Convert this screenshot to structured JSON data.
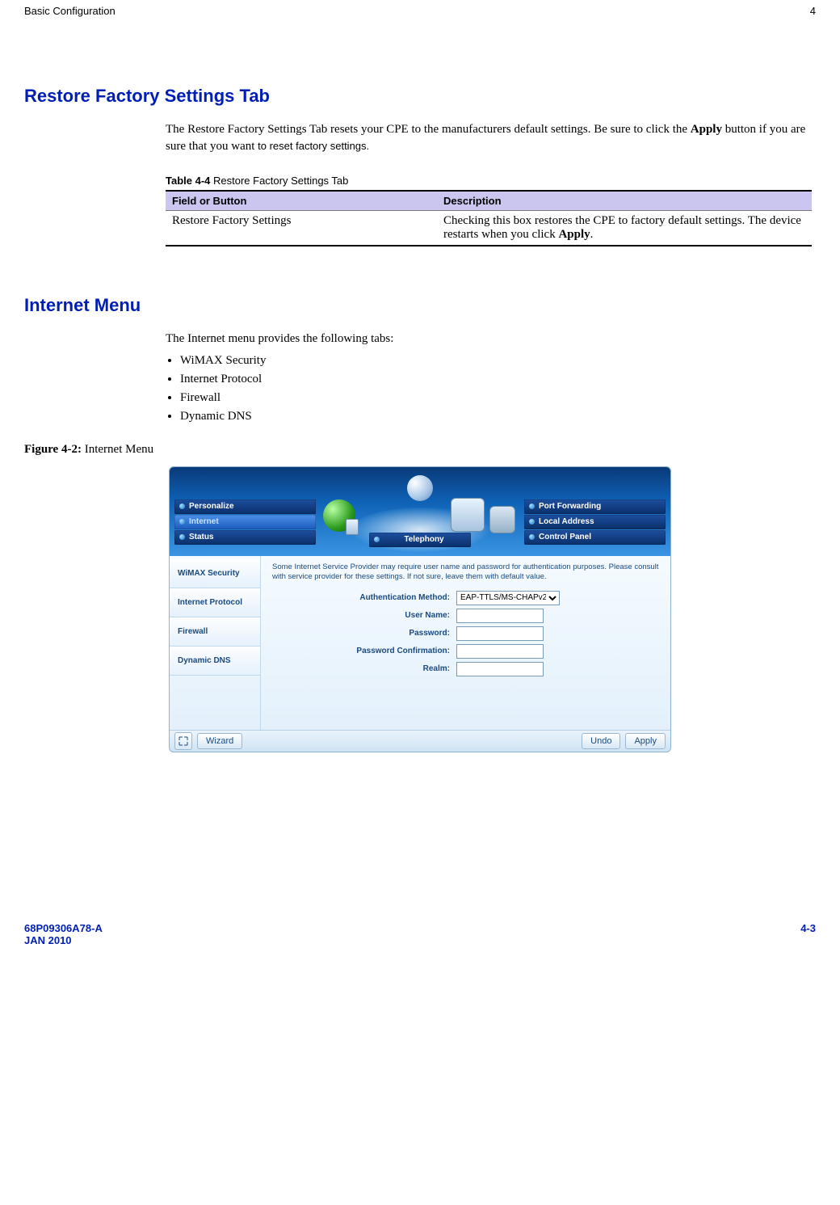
{
  "header": {
    "left": "Basic Configuration",
    "right": "4"
  },
  "section1": {
    "heading": "Restore Factory Settings Tab",
    "body_html": "The Restore Factory Settings Tab resets your CPE to the manufacturers default settings. Be sure to click the <b>Apply</b> button if you are sure that you want <span class='sans'>to reset factory settings.</span>",
    "table_caption_html": "<b>Table 4-4</b> Restore Factory Settings Tab",
    "table": {
      "headers": [
        "Field or Button",
        "Description"
      ],
      "rows": [
        {
          "field": "Restore Factory Settings",
          "desc_html": "Checking this box restores the CPE to factory default settings. The device restarts when you click <b>Apply</b>."
        }
      ]
    }
  },
  "section2": {
    "heading": "Internet Menu",
    "intro": "The Internet menu provides the following tabs:",
    "tabs": [
      "WiMAX Security",
      "Internet Protocol",
      "Firewall",
      "Dynamic DNS"
    ],
    "figure_caption_html": "<b>Figure 4-2:</b> Internet Menu"
  },
  "screenshot": {
    "nav_left": [
      {
        "label": "Personalize",
        "selected": false
      },
      {
        "label": "Internet",
        "selected": true
      },
      {
        "label": "Status",
        "selected": false
      }
    ],
    "nav_right": [
      {
        "label": "Port Forwarding",
        "selected": false
      },
      {
        "label": "Local Address",
        "selected": false
      },
      {
        "label": "Control Panel",
        "selected": false
      }
    ],
    "center_tab": "Telephony",
    "side_tabs": [
      "WiMAX Security",
      "Internet Protocol",
      "Firewall",
      "Dynamic DNS"
    ],
    "hint": "Some Internet Service Provider may require user name and password for authentication purposes. Please consult with service provider for these settings. If not sure, leave them with default value.",
    "form": {
      "auth_label": "Authentication Method:",
      "auth_value": "EAP-TTLS/MS-CHAPv2",
      "user_label": "User Name:",
      "user_value": "",
      "pass_label": "Password:",
      "pass_value": "",
      "confirm_label": "Password Confirmation:",
      "confirm_value": "",
      "realm_label": "Realm:",
      "realm_value": ""
    },
    "footer": {
      "wizard": "Wizard",
      "undo": "Undo",
      "apply": "Apply"
    }
  },
  "footer": {
    "doc": "68P09306A78-A",
    "date": "JAN 2010",
    "page": "4-3"
  }
}
